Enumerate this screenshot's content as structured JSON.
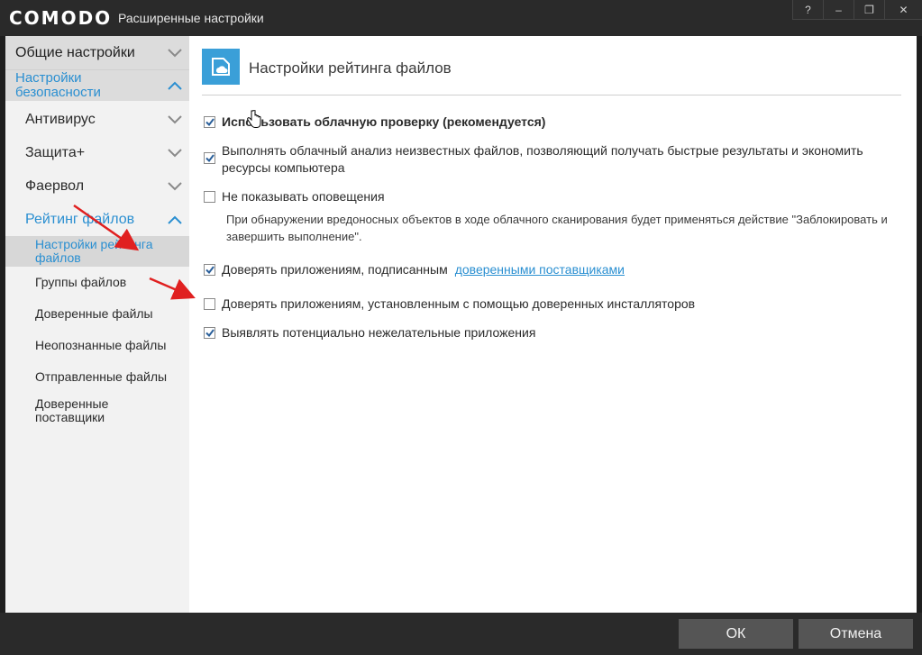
{
  "titlebar": {
    "brand": "COMODO",
    "title": "Расширенные настройки",
    "buttons": [
      "?",
      "–",
      "❐",
      "✕"
    ]
  },
  "sidebar": {
    "general": "Общие настройки",
    "security_line1": "Настройки",
    "security_line2": "безопасности",
    "items": [
      {
        "label": "Антивирус"
      },
      {
        "label": "Защита+"
      },
      {
        "label": "Фаервол"
      },
      {
        "label": "Рейтинг файлов"
      }
    ],
    "subitems": [
      {
        "label": "Настройки рейтинга файлов",
        "line1": "Настройки рейтинга",
        "line2": "файлов"
      },
      {
        "label": "Группы файлов"
      },
      {
        "label": "Доверенные файлы"
      },
      {
        "label": "Неопознанные файлы"
      },
      {
        "label": "Отправленные файлы"
      },
      {
        "label": "Доверенные поставщики",
        "line1": "Доверенные",
        "line2": "поставщики"
      }
    ]
  },
  "content": {
    "title": "Настройки рейтинга файлов",
    "icon": "cloud-file-icon",
    "options": [
      {
        "label": "Использовать облачную проверку (рекомендуется)",
        "checked": true
      },
      {
        "label_line1": "Выполнять облачный анализ неизвестных файлов, позволяющий получать быстрые результаты и экономить",
        "label_line2": "ресурсы компьютера",
        "checked": true
      },
      {
        "label": "Не показывать оповещения",
        "checked": false
      },
      {
        "label": "Доверять приложениям, подписанным",
        "link": "доверенными поставщиками",
        "checked": true
      },
      {
        "label": "Доверять приложениям, установленным с помощью доверенных инсталляторов",
        "checked": false
      },
      {
        "label": "Выявлять потенциально нежелательные приложения",
        "checked": true
      }
    ],
    "note_line1": "При обнаружении вредоносных объектов в ходе облачного сканирования будет применяться действие \"Заблокировать и",
    "note_line2": "завершить выполнение\"."
  },
  "footer": {
    "ok": "ОК",
    "cancel": "Отмена"
  },
  "colors": {
    "accent": "#2a8fd1",
    "dark_bg": "#2a2a2a",
    "annotation_arrow": "#e02020"
  }
}
